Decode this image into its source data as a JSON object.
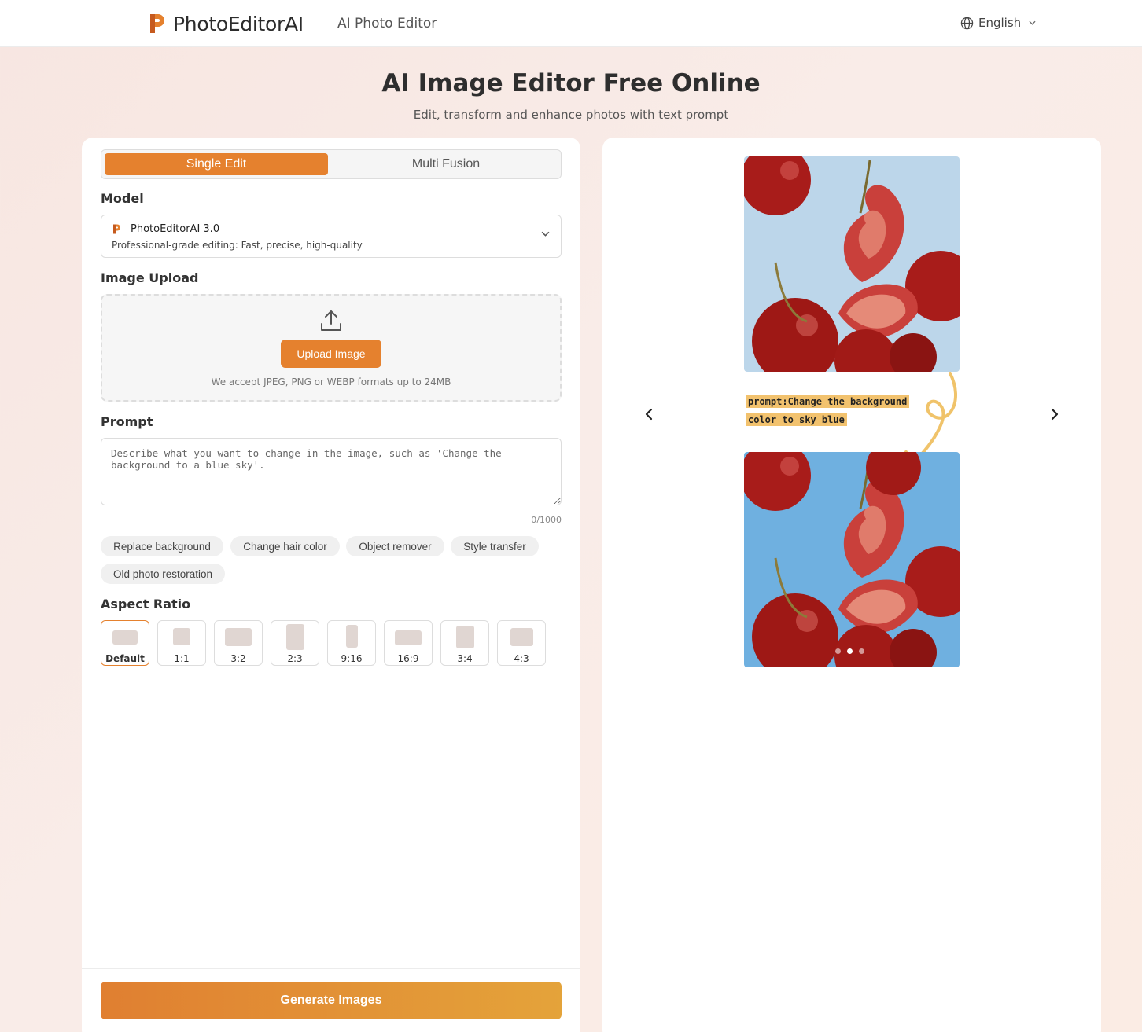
{
  "header": {
    "brand": "PhotoEditorAI",
    "nav_link": "AI Photo Editor",
    "language": "English"
  },
  "hero": {
    "title": "AI Image Editor Free Online",
    "subtitle": "Edit, transform and enhance photos with text prompt"
  },
  "tabs": {
    "single": "Single Edit",
    "multi": "Multi Fusion"
  },
  "model": {
    "label": "Model",
    "name": "PhotoEditorAI 3.0",
    "description": "Professional-grade editing: Fast, precise, high-quality"
  },
  "upload": {
    "label": "Image Upload",
    "button": "Upload Image",
    "hint": "We accept JPEG, PNG or WEBP formats up to 24MB"
  },
  "prompt": {
    "label": "Prompt",
    "placeholder": "Describe what you want to change in the image, such as 'Change the background to a blue sky'.",
    "counter": "0/1000"
  },
  "chips": [
    "Replace background",
    "Change hair color",
    "Object remover",
    "Style transfer",
    "Old photo restoration"
  ],
  "aspect": {
    "label": "Aspect Ratio",
    "options": [
      "Default",
      "1:1",
      "3:2",
      "2:3",
      "9:16",
      "16:9",
      "3:4",
      "4:3"
    ],
    "selected": "Default"
  },
  "generate_label": "Generate Images",
  "preview": {
    "prompt_line1": "prompt:Change the background",
    "prompt_line2": "color to sky blue",
    "slide_count": 3,
    "active_slide": 2,
    "colors": {
      "before_bg": "#bcd6ea",
      "after_bg": "#6fb0e0",
      "cherry": "#b3201d",
      "arrow": "#f0c36a"
    }
  },
  "colors": {
    "accent": "#e5812e",
    "accent_gradient_end": "#e4a33a"
  },
  "icons": {
    "globe": "globe-icon",
    "chevron": "chevron-down-icon",
    "upload": "upload-icon",
    "prev": "chevron-left-icon",
    "next": "chevron-right-icon"
  }
}
